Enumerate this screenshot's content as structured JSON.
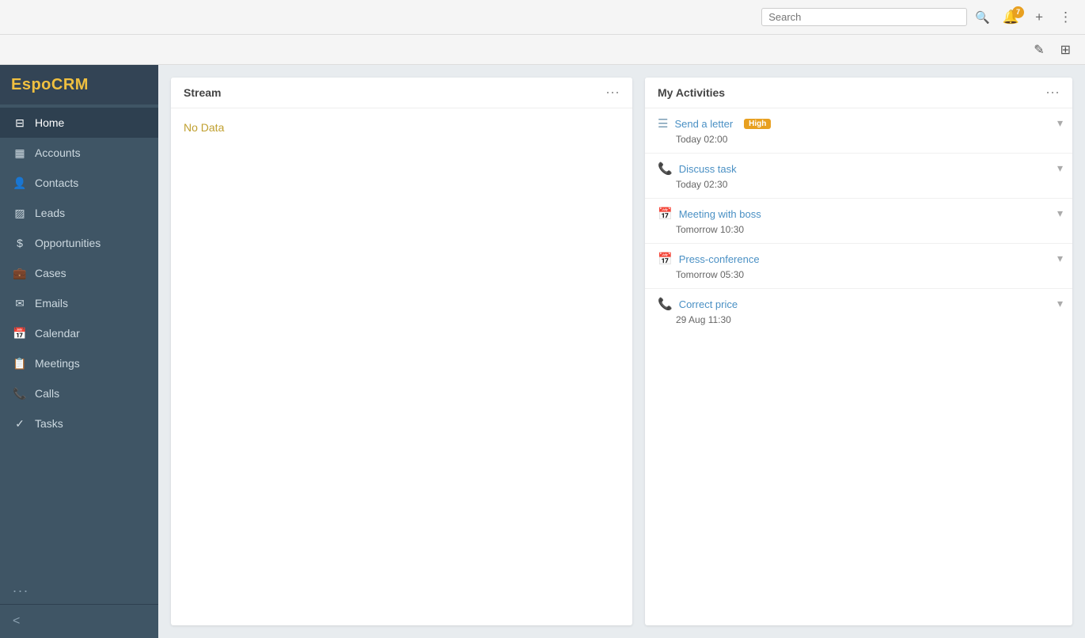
{
  "topbar": {
    "search_placeholder": "Search",
    "notification_count": "7",
    "search_icon": "🔍",
    "bell_icon": "🔔",
    "plus_icon": "+",
    "menu_icon": "⋮"
  },
  "toolbar2": {
    "edit_icon": "✎",
    "grid_icon": "⊞"
  },
  "logo": {
    "text_black": "Espo",
    "text_yellow": "CRM"
  },
  "sidebar": {
    "items": [
      {
        "id": "home",
        "label": "Home",
        "icon": "⊟",
        "active": true
      },
      {
        "id": "accounts",
        "label": "Accounts",
        "icon": "▦"
      },
      {
        "id": "contacts",
        "label": "Contacts",
        "icon": "👤"
      },
      {
        "id": "leads",
        "label": "Leads",
        "icon": "▨"
      },
      {
        "id": "opportunities",
        "label": "Opportunities",
        "icon": "$"
      },
      {
        "id": "cases",
        "label": "Cases",
        "icon": "💼"
      },
      {
        "id": "emails",
        "label": "Emails",
        "icon": "✉"
      },
      {
        "id": "calendar",
        "label": "Calendar",
        "icon": "📅"
      },
      {
        "id": "meetings",
        "label": "Meetings",
        "icon": "📋"
      },
      {
        "id": "calls",
        "label": "Calls",
        "icon": "📞"
      },
      {
        "id": "tasks",
        "label": "Tasks",
        "icon": "✓"
      }
    ],
    "more_label": "...",
    "collapse_icon": "<"
  },
  "stream_panel": {
    "title": "Stream",
    "menu_icon": "⋯",
    "no_data_label": "No Data"
  },
  "activities_panel": {
    "title": "My Activities",
    "menu_icon": "⋯",
    "items": [
      {
        "id": "send-letter",
        "icon_type": "task",
        "title": "Send a letter",
        "time": "Today 02:00",
        "badge": "High",
        "has_badge": true
      },
      {
        "id": "discuss-task",
        "icon_type": "call",
        "title": "Discuss task",
        "time": "Today 02:30",
        "has_badge": false
      },
      {
        "id": "meeting-with-boss",
        "icon_type": "meeting",
        "title": "Meeting with boss",
        "time": "Tomorrow 10:30",
        "has_badge": false
      },
      {
        "id": "press-conference",
        "icon_type": "meeting",
        "title": "Press-conference",
        "time": "Tomorrow 05:30",
        "has_badge": false
      },
      {
        "id": "correct-price",
        "icon_type": "call",
        "title": "Correct price",
        "time": "29 Aug 11:30",
        "has_badge": false
      }
    ]
  }
}
